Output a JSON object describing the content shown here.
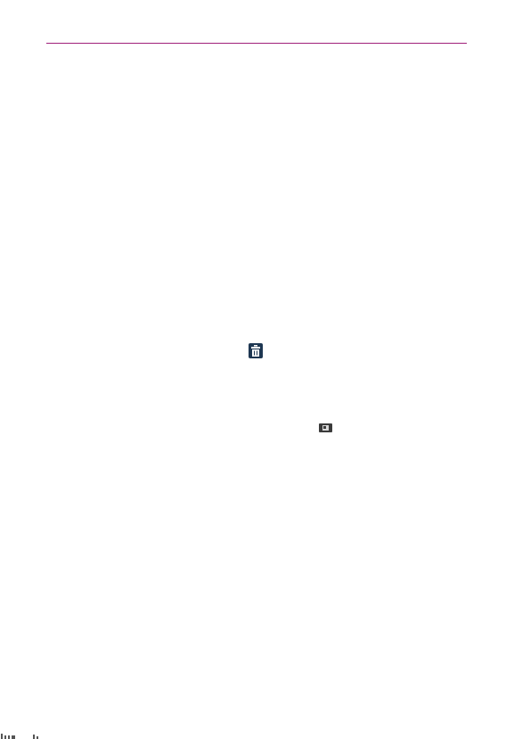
{
  "header": {
    "rule_color": "#a0207a"
  },
  "icons": {
    "trash": {
      "name": "trash-icon",
      "color": "#1e3752"
    },
    "screen": {
      "name": "screen-icon",
      "color": "#3b3b3b"
    }
  },
  "footer": {
    "mark_color": "#555555"
  }
}
